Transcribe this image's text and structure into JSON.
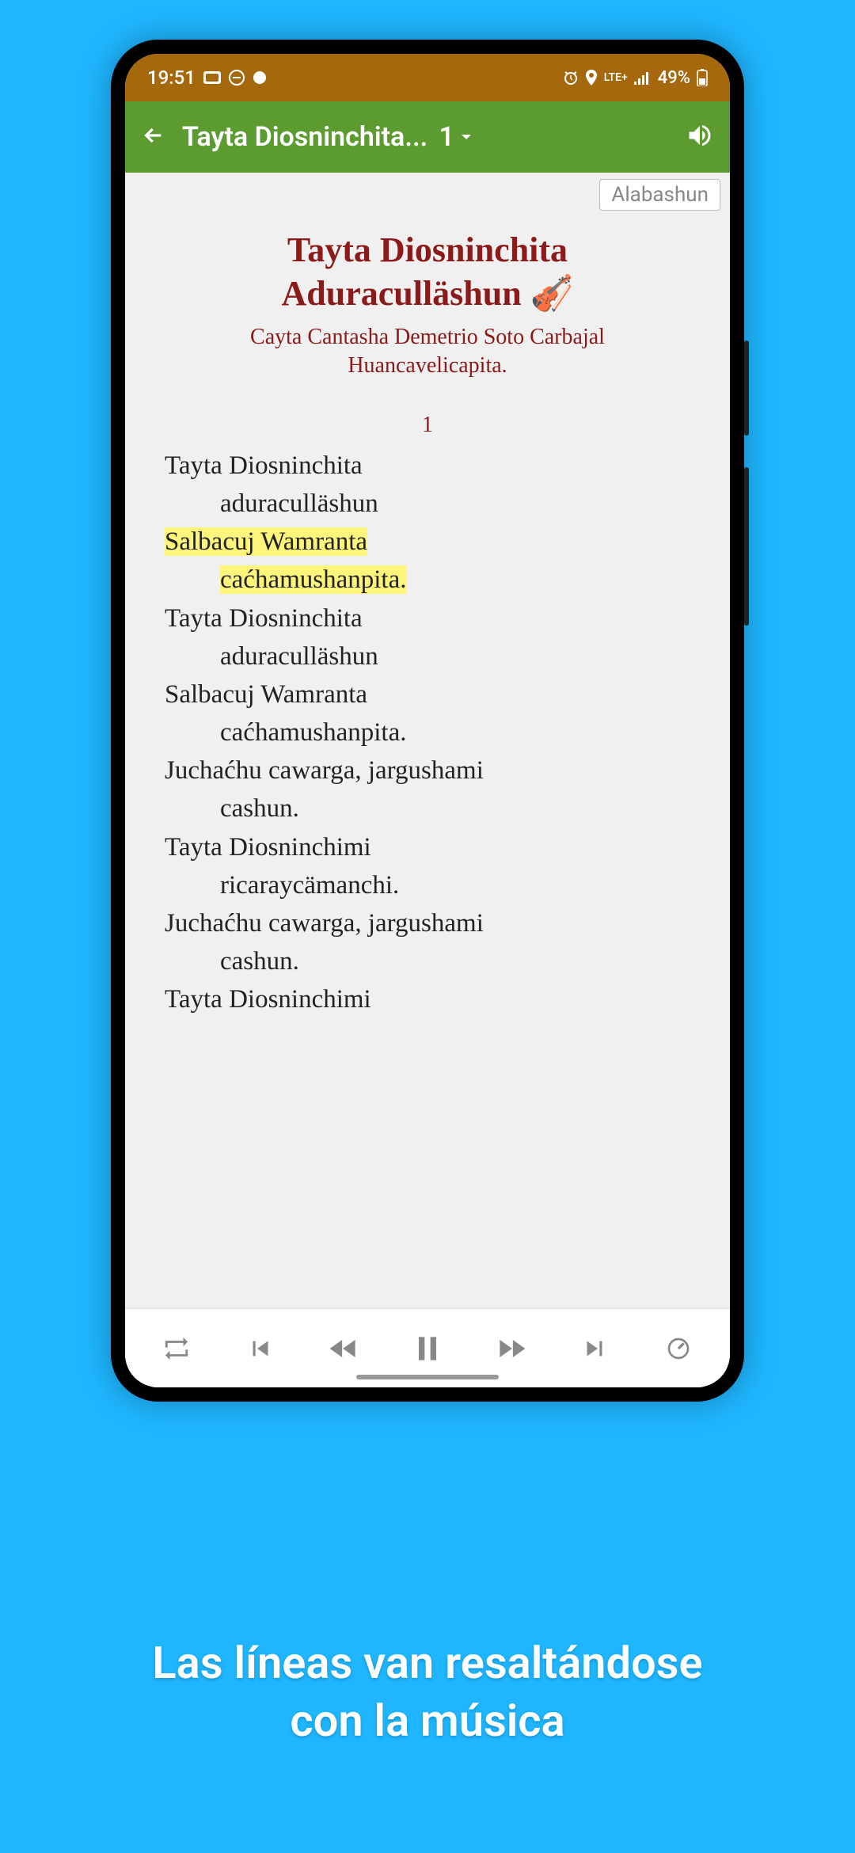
{
  "status": {
    "time": "19:51",
    "battery_text": "49%",
    "network": "LTE+"
  },
  "appbar": {
    "title": "Tayta Diosninchita...",
    "chapter": "1"
  },
  "tag": "Alabashun",
  "song": {
    "title_line1": "Tayta Diosninchita",
    "title_line2": "Aduraculläshun",
    "subtitle_line1": "Cayta Cantasha Demetrio Soto Carbajal",
    "subtitle_line2": "Huancavelicapita.",
    "verse_number": "1"
  },
  "lyrics": [
    {
      "text": "Tayta Diosninchita",
      "indent": false,
      "hl": false
    },
    {
      "text": "aduraculläshun",
      "indent": true,
      "hl": false
    },
    {
      "text": "Salbacuj Wamranta",
      "indent": false,
      "hl": true
    },
    {
      "text": "caćhamushanpita.",
      "indent": true,
      "hl": true
    },
    {
      "text": "Tayta Diosninchita",
      "indent": false,
      "hl": false
    },
    {
      "text": "aduraculläshun",
      "indent": true,
      "hl": false
    },
    {
      "text": "Salbacuj Wamranta",
      "indent": false,
      "hl": false
    },
    {
      "text": "caćhamushanpita.",
      "indent": true,
      "hl": false
    },
    {
      "text": "Juchaćhu cawarga, jargushami",
      "indent": false,
      "hl": false
    },
    {
      "text": "cashun.",
      "indent": true,
      "hl": false
    },
    {
      "text": "Tayta Diosninchimi",
      "indent": false,
      "hl": false
    },
    {
      "text": "ricaraycämanchi.",
      "indent": true,
      "hl": false
    },
    {
      "text": "Juchaćhu cawarga, jargushami",
      "indent": false,
      "hl": false
    },
    {
      "text": "cashun.",
      "indent": true,
      "hl": false
    },
    {
      "text": "Tayta Diosninchimi",
      "indent": false,
      "hl": false
    }
  ],
  "caption": {
    "line1": "Las líneas van resaltándose",
    "line2": "con la música"
  }
}
